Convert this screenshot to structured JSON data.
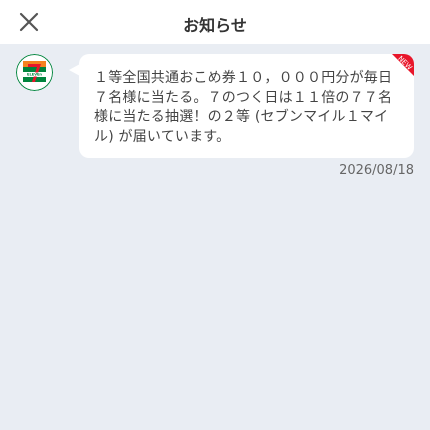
{
  "header": {
    "title": "お知らせ",
    "close_icon": "close-icon"
  },
  "notification": {
    "sender_logo": "7-eleven-logo",
    "logo_text": "ELEVEn",
    "message": "１等全国共通おこめ券１０，０００円分が毎日７名様に当たる。７のつく日は１１倍の７７名様に当たる抽選！の２等 (セブンマイル１マイル) が届いています。",
    "badge": "NEW",
    "date": "2026/08/18"
  },
  "colors": {
    "background": "#e9edf3",
    "header_bg": "#ffffff",
    "bubble_bg": "#ffffff",
    "badge_red": "#e8162a",
    "seven_orange": "#f58220",
    "seven_green": "#00843d",
    "seven_red": "#e8162a"
  }
}
